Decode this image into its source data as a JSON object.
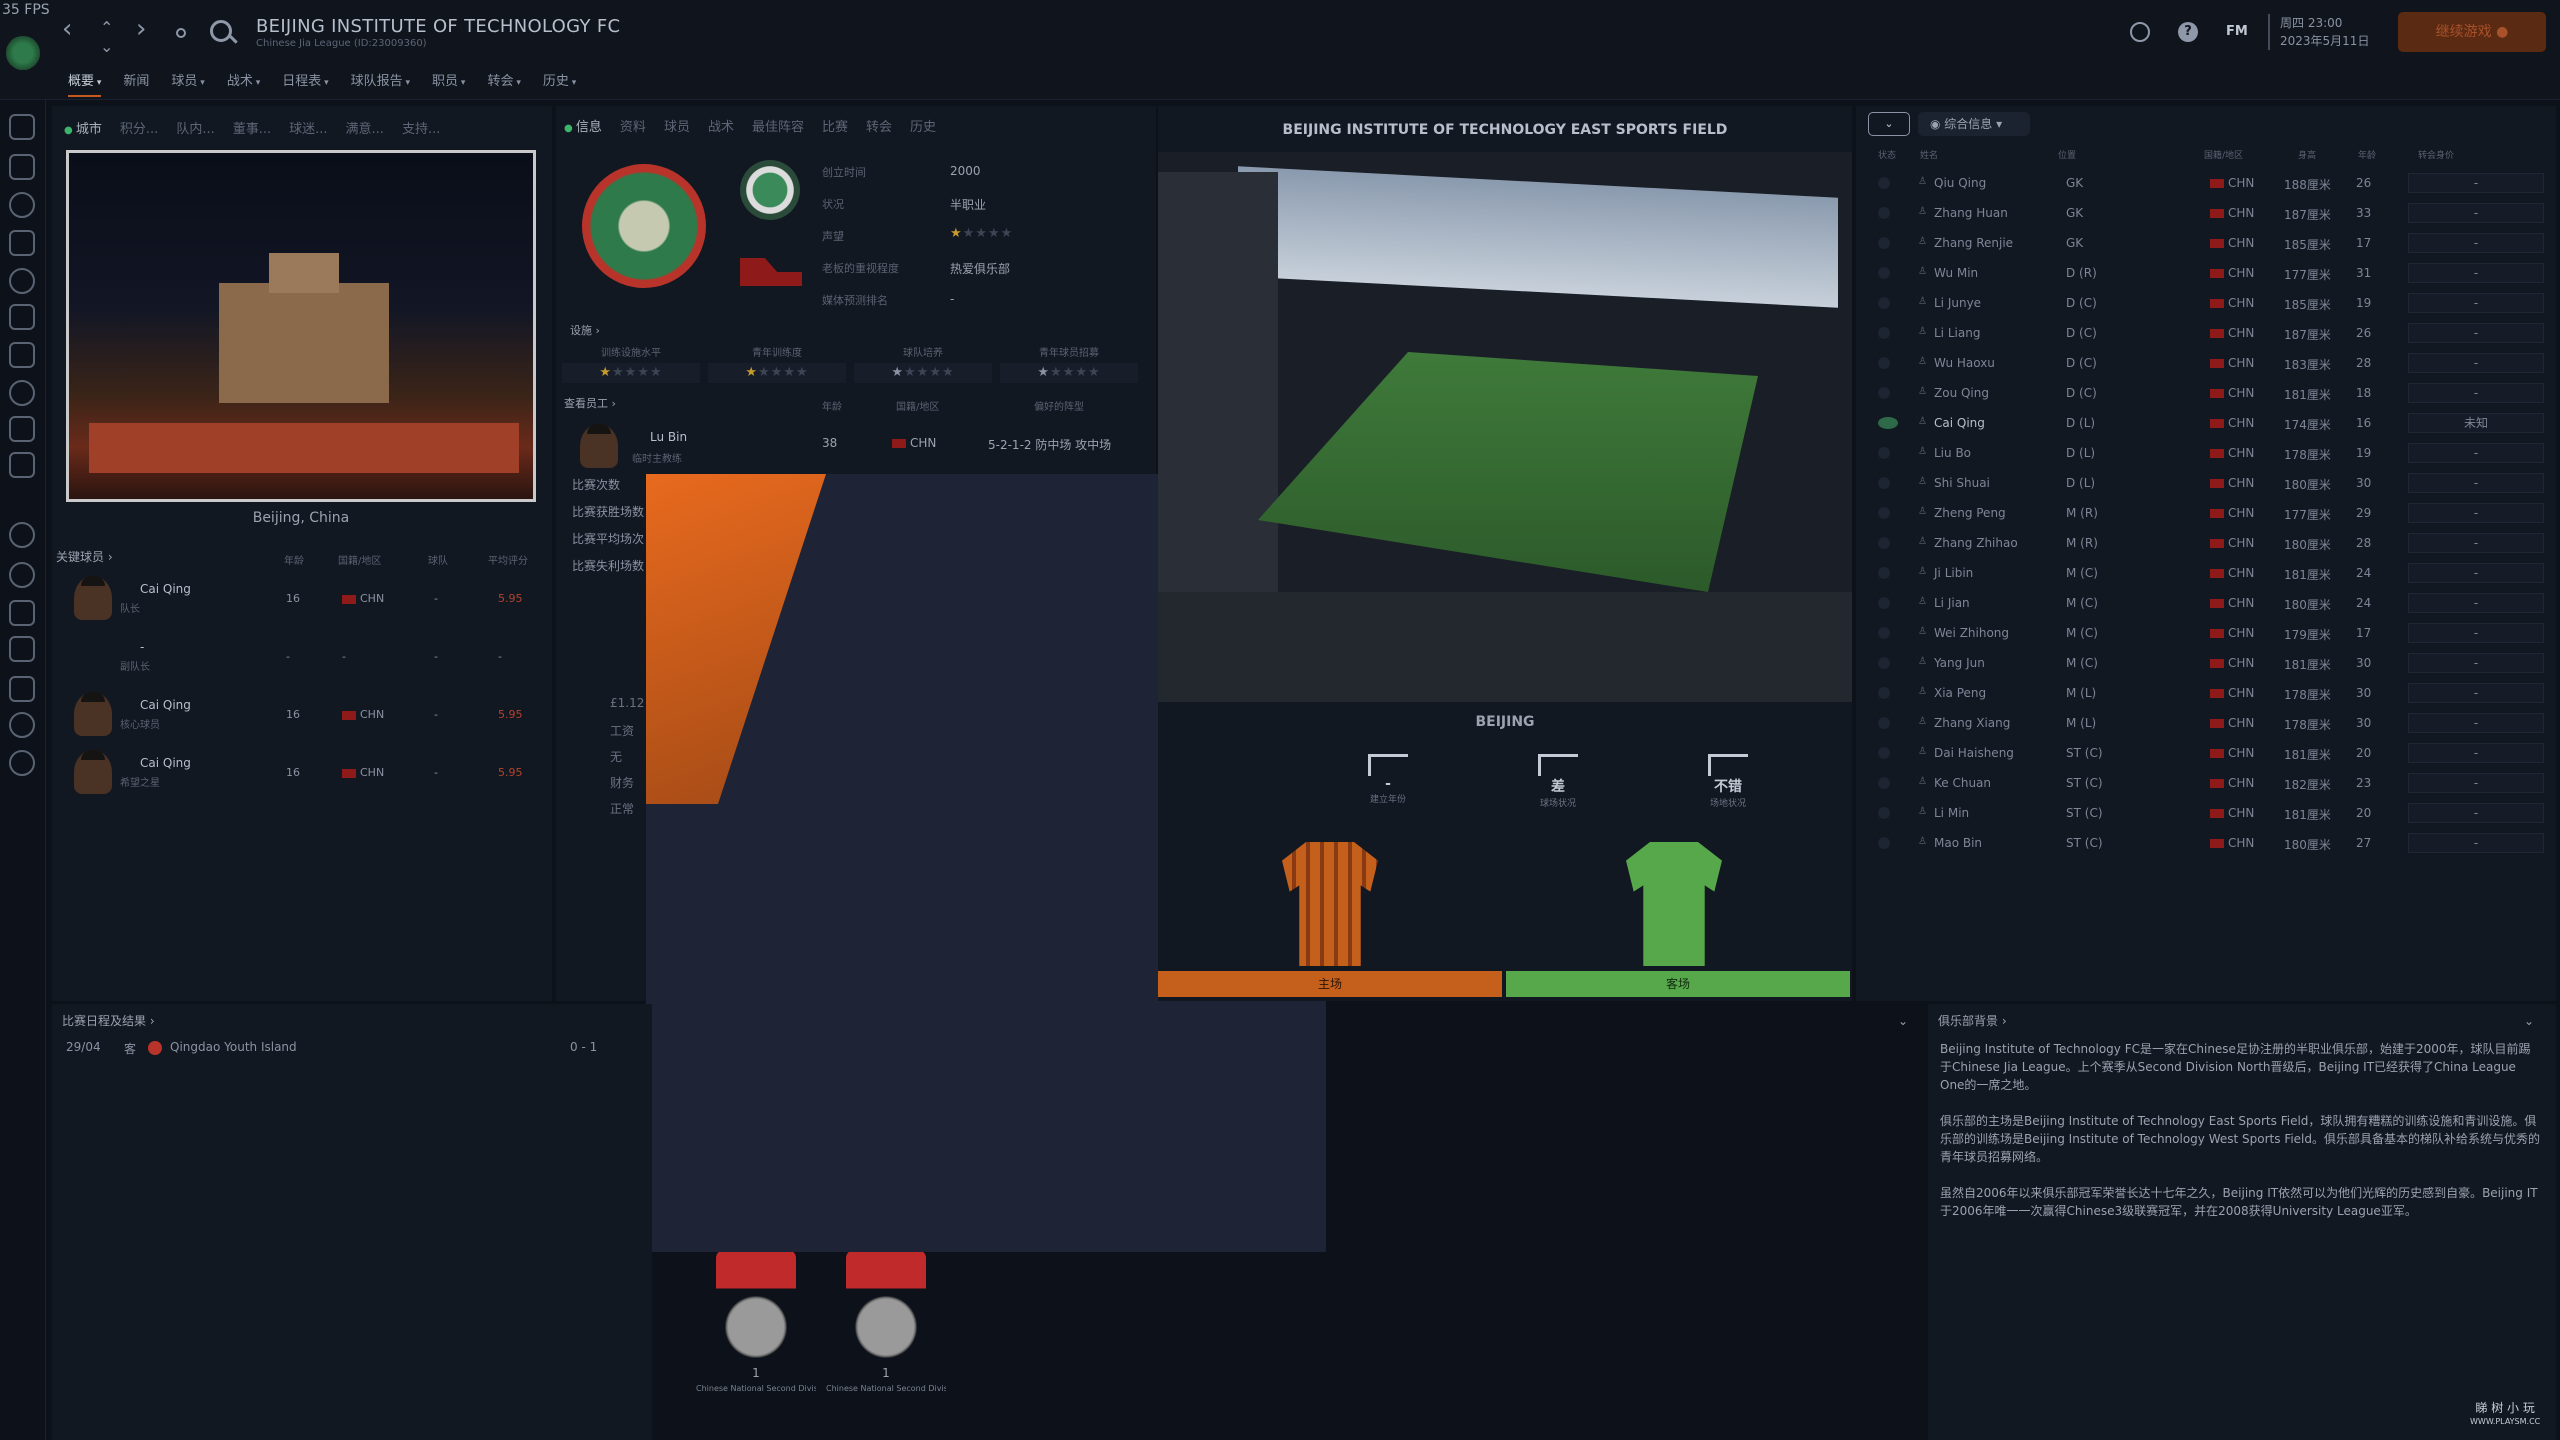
{
  "fps": "35 FPS",
  "header": {
    "club_name": "BEIJING INSTITUTE OF TECHNOLOGY FC",
    "club_sub": "Chinese Jia League (ID:23009360)",
    "menu": [
      "概要",
      "新闻",
      "球员",
      "战术",
      "日程表",
      "球队报告",
      "职员",
      "转会",
      "历史"
    ],
    "date_day": "周四 23:00",
    "date_full": "2023年5月11日",
    "fm_label": "FM",
    "continue_label": "继续游戏"
  },
  "left": {
    "tabs": [
      "城市",
      "积分...",
      "队内...",
      "董事...",
      "球迷...",
      "满意...",
      "支持..."
    ],
    "city_caption": "Beijing, China",
    "key_players_title": "关键球员 ›",
    "kp_headers": [
      "年龄",
      "国籍/地区",
      "球队",
      "平均评分"
    ],
    "key_players": [
      {
        "name": "Cai Qing",
        "role": "队长",
        "age": "16",
        "nat": "CHN",
        "team": "-",
        "rating": "5.95"
      },
      {
        "name": "-",
        "role": "副队长",
        "age": "-",
        "nat": "-",
        "team": "-",
        "rating": "-"
      },
      {
        "name": "Cai Qing",
        "role": "核心球员",
        "age": "16",
        "nat": "CHN",
        "team": "-",
        "rating": "5.95"
      },
      {
        "name": "Cai Qing",
        "role": "希望之星",
        "age": "16",
        "nat": "CHN",
        "team": "-",
        "rating": "5.95"
      }
    ]
  },
  "middle": {
    "tabs": [
      "信息",
      "资料",
      "球员",
      "战术",
      "最佳阵容",
      "比赛",
      "转会",
      "历史"
    ],
    "info_labels": [
      "创立时间",
      "状况",
      "声望",
      "老板的重视程度",
      "媒体预测排名"
    ],
    "info_values": [
      "2000",
      "半职业",
      "",
      "热爱俱乐部",
      "-"
    ],
    "facilities_title": "设施 ›",
    "facility_labels": [
      "训练设施水平",
      "青年训练度",
      "球队培养",
      "青年球员招募"
    ],
    "staff_title": "查看员工 ›",
    "staff_headers": [
      "年龄",
      "国籍/地区",
      "偏好的阵型"
    ],
    "staff": {
      "name": "Lu Bin",
      "role": "临时主教练",
      "age": "38",
      "nat": "CHN",
      "formation": "5-2-1-2 防中场 攻中场"
    },
    "stats_labels": [
      "比赛次数",
      "比赛获胜场数",
      "比赛平均场次",
      "比赛失利场数"
    ],
    "finance_partial": [
      "£1.12",
      "工资",
      "无",
      "财务",
      "正常"
    ],
    "trophies": [
      {
        "count": "1",
        "name": "Chinese National Second Division"
      },
      {
        "count": "1",
        "name": "Chinese National Second Division Northern G..."
      }
    ]
  },
  "stadium": {
    "name": "BEIJING INSTITUTE OF TECHNOLOGY EAST SPORTS FIELD",
    "city": "BEIJING",
    "icons": [
      {
        "value": "-",
        "label": "建立年份"
      },
      {
        "value": "差",
        "label": "球场状况"
      },
      {
        "value": "不错",
        "label": "场地状况"
      }
    ],
    "kit_home": "主场",
    "kit_away": "客场"
  },
  "squad": {
    "filter_label": "综合信息",
    "headers": [
      "状态",
      "姓名",
      "位置",
      "国籍/地区",
      "身高",
      "年龄",
      "转会身价"
    ],
    "players": [
      {
        "name": "Qiu Qing",
        "pos": "GK",
        "nat": "CHN",
        "height": "188厘米",
        "age": "26",
        "value": "-"
      },
      {
        "name": "Zhang Huan",
        "pos": "GK",
        "nat": "CHN",
        "height": "187厘米",
        "age": "33",
        "value": "-"
      },
      {
        "name": "Zhang Renjie",
        "pos": "GK",
        "nat": "CHN",
        "height": "185厘米",
        "age": "17",
        "value": "-"
      },
      {
        "name": "Wu Min",
        "pos": "D (R)",
        "nat": "CHN",
        "height": "177厘米",
        "age": "31",
        "value": "-"
      },
      {
        "name": "Li Junye",
        "pos": "D (C)",
        "nat": "CHN",
        "height": "185厘米",
        "age": "19",
        "value": "-"
      },
      {
        "name": "Li Liang",
        "pos": "D (C)",
        "nat": "CHN",
        "height": "187厘米",
        "age": "26",
        "value": "-"
      },
      {
        "name": "Wu Haoxu",
        "pos": "D (C)",
        "nat": "CHN",
        "height": "183厘米",
        "age": "28",
        "value": "-"
      },
      {
        "name": "Zou Qing",
        "pos": "D (C)",
        "nat": "CHN",
        "height": "181厘米",
        "age": "18",
        "value": "-"
      },
      {
        "name": "Cai Qing",
        "pos": "D (L)",
        "nat": "CHN",
        "height": "174厘米",
        "age": "16",
        "value": "未知"
      },
      {
        "name": "Liu Bo",
        "pos": "D (L)",
        "nat": "CHN",
        "height": "178厘米",
        "age": "19",
        "value": "-"
      },
      {
        "name": "Shi Shuai",
        "pos": "D (L)",
        "nat": "CHN",
        "height": "180厘米",
        "age": "30",
        "value": "-"
      },
      {
        "name": "Zheng Peng",
        "pos": "M (R)",
        "nat": "CHN",
        "height": "177厘米",
        "age": "29",
        "value": "-"
      },
      {
        "name": "Zhang Zhihao",
        "pos": "M (R)",
        "nat": "CHN",
        "height": "180厘米",
        "age": "28",
        "value": "-"
      },
      {
        "name": "Ji Libin",
        "pos": "M (C)",
        "nat": "CHN",
        "height": "181厘米",
        "age": "24",
        "value": "-"
      },
      {
        "name": "Li Jian",
        "pos": "M (C)",
        "nat": "CHN",
        "height": "180厘米",
        "age": "24",
        "value": "-"
      },
      {
        "name": "Wei Zhihong",
        "pos": "M (C)",
        "nat": "CHN",
        "height": "179厘米",
        "age": "17",
        "value": "-"
      },
      {
        "name": "Yang Jun",
        "pos": "M (C)",
        "nat": "CHN",
        "height": "181厘米",
        "age": "30",
        "value": "-"
      },
      {
        "name": "Xia Peng",
        "pos": "M (L)",
        "nat": "CHN",
        "height": "178厘米",
        "age": "30",
        "value": "-"
      },
      {
        "name": "Zhang Xiang",
        "pos": "M (L)",
        "nat": "CHN",
        "height": "178厘米",
        "age": "30",
        "value": "-"
      },
      {
        "name": "Dai Haisheng",
        "pos": "ST (C)",
        "nat": "CHN",
        "height": "181厘米",
        "age": "20",
        "value": "-"
      },
      {
        "name": "Ke Chuan",
        "pos": "ST (C)",
        "nat": "CHN",
        "height": "182厘米",
        "age": "23",
        "value": "-"
      },
      {
        "name": "Li Min",
        "pos": "ST (C)",
        "nat": "CHN",
        "height": "181厘米",
        "age": "20",
        "value": "-"
      },
      {
        "name": "Mao Bin",
        "pos": "ST (C)",
        "nat": "CHN",
        "height": "180厘米",
        "age": "27",
        "value": "-"
      }
    ]
  },
  "fixtures": {
    "title": "比赛日程及结果 ›",
    "items": [
      {
        "date": "29/04",
        "venue": "客",
        "opponent": "Qingdao Youth Island",
        "score": "0 - 1"
      }
    ]
  },
  "history": {
    "title": "俱乐部背景 ›",
    "paragraphs": [
      "Beijing Institute of Technology FC是一家在Chinese足协注册的半职业俱乐部，始建于2000年，球队目前踢于Chinese Jia League。上个赛季从Second Division North晋级后，Beijing IT已经获得了China League One的一席之地。",
      "俱乐部的主场是Beijing Institute of Technology East Sports Field，球队拥有糟糕的训练设施和青训设施。俱乐部的训练场是Beijing Institute of Technology West Sports Field。俱乐部具备基本的梯队补给系统与优秀的青年球员招募网络。",
      "虽然自2006年以来俱乐部冠军荣誉长达十七年之久，Beijing IT依然可以为他们光辉的历史感到自豪。Beijing IT于2006年唯一一次赢得Chinese3级联赛冠军，并在2008获得University League亚军。"
    ]
  },
  "watermark": {
    "line1": "睇 树 小 玩",
    "line2": "WWW.PLAYSM.CC"
  },
  "colors": {
    "accent": "#c65a1e",
    "home_kit": "#c5601c",
    "away_kit": "#56a84a",
    "chn_flag": "#8e1a1a"
  }
}
